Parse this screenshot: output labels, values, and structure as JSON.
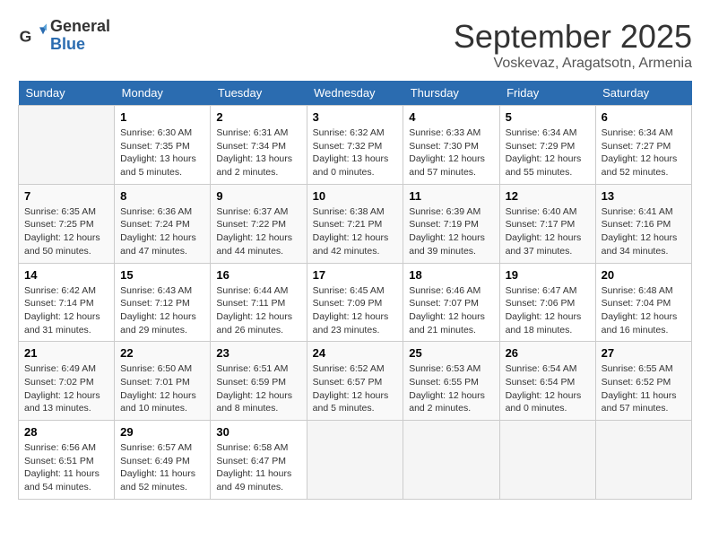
{
  "logo": {
    "general": "General",
    "blue": "Blue"
  },
  "header": {
    "month": "September 2025",
    "location": "Voskevaz, Aragatsotn, Armenia"
  },
  "days_of_week": [
    "Sunday",
    "Monday",
    "Tuesday",
    "Wednesday",
    "Thursday",
    "Friday",
    "Saturday"
  ],
  "weeks": [
    [
      {
        "day": "",
        "info": ""
      },
      {
        "day": "1",
        "info": "Sunrise: 6:30 AM\nSunset: 7:35 PM\nDaylight: 13 hours\nand 5 minutes."
      },
      {
        "day": "2",
        "info": "Sunrise: 6:31 AM\nSunset: 7:34 PM\nDaylight: 13 hours\nand 2 minutes."
      },
      {
        "day": "3",
        "info": "Sunrise: 6:32 AM\nSunset: 7:32 PM\nDaylight: 13 hours\nand 0 minutes."
      },
      {
        "day": "4",
        "info": "Sunrise: 6:33 AM\nSunset: 7:30 PM\nDaylight: 12 hours\nand 57 minutes."
      },
      {
        "day": "5",
        "info": "Sunrise: 6:34 AM\nSunset: 7:29 PM\nDaylight: 12 hours\nand 55 minutes."
      },
      {
        "day": "6",
        "info": "Sunrise: 6:34 AM\nSunset: 7:27 PM\nDaylight: 12 hours\nand 52 minutes."
      }
    ],
    [
      {
        "day": "7",
        "info": "Sunrise: 6:35 AM\nSunset: 7:25 PM\nDaylight: 12 hours\nand 50 minutes."
      },
      {
        "day": "8",
        "info": "Sunrise: 6:36 AM\nSunset: 7:24 PM\nDaylight: 12 hours\nand 47 minutes."
      },
      {
        "day": "9",
        "info": "Sunrise: 6:37 AM\nSunset: 7:22 PM\nDaylight: 12 hours\nand 44 minutes."
      },
      {
        "day": "10",
        "info": "Sunrise: 6:38 AM\nSunset: 7:21 PM\nDaylight: 12 hours\nand 42 minutes."
      },
      {
        "day": "11",
        "info": "Sunrise: 6:39 AM\nSunset: 7:19 PM\nDaylight: 12 hours\nand 39 minutes."
      },
      {
        "day": "12",
        "info": "Sunrise: 6:40 AM\nSunset: 7:17 PM\nDaylight: 12 hours\nand 37 minutes."
      },
      {
        "day": "13",
        "info": "Sunrise: 6:41 AM\nSunset: 7:16 PM\nDaylight: 12 hours\nand 34 minutes."
      }
    ],
    [
      {
        "day": "14",
        "info": "Sunrise: 6:42 AM\nSunset: 7:14 PM\nDaylight: 12 hours\nand 31 minutes."
      },
      {
        "day": "15",
        "info": "Sunrise: 6:43 AM\nSunset: 7:12 PM\nDaylight: 12 hours\nand 29 minutes."
      },
      {
        "day": "16",
        "info": "Sunrise: 6:44 AM\nSunset: 7:11 PM\nDaylight: 12 hours\nand 26 minutes."
      },
      {
        "day": "17",
        "info": "Sunrise: 6:45 AM\nSunset: 7:09 PM\nDaylight: 12 hours\nand 23 minutes."
      },
      {
        "day": "18",
        "info": "Sunrise: 6:46 AM\nSunset: 7:07 PM\nDaylight: 12 hours\nand 21 minutes."
      },
      {
        "day": "19",
        "info": "Sunrise: 6:47 AM\nSunset: 7:06 PM\nDaylight: 12 hours\nand 18 minutes."
      },
      {
        "day": "20",
        "info": "Sunrise: 6:48 AM\nSunset: 7:04 PM\nDaylight: 12 hours\nand 16 minutes."
      }
    ],
    [
      {
        "day": "21",
        "info": "Sunrise: 6:49 AM\nSunset: 7:02 PM\nDaylight: 12 hours\nand 13 minutes."
      },
      {
        "day": "22",
        "info": "Sunrise: 6:50 AM\nSunset: 7:01 PM\nDaylight: 12 hours\nand 10 minutes."
      },
      {
        "day": "23",
        "info": "Sunrise: 6:51 AM\nSunset: 6:59 PM\nDaylight: 12 hours\nand 8 minutes."
      },
      {
        "day": "24",
        "info": "Sunrise: 6:52 AM\nSunset: 6:57 PM\nDaylight: 12 hours\nand 5 minutes."
      },
      {
        "day": "25",
        "info": "Sunrise: 6:53 AM\nSunset: 6:55 PM\nDaylight: 12 hours\nand 2 minutes."
      },
      {
        "day": "26",
        "info": "Sunrise: 6:54 AM\nSunset: 6:54 PM\nDaylight: 12 hours\nand 0 minutes."
      },
      {
        "day": "27",
        "info": "Sunrise: 6:55 AM\nSunset: 6:52 PM\nDaylight: 11 hours\nand 57 minutes."
      }
    ],
    [
      {
        "day": "28",
        "info": "Sunrise: 6:56 AM\nSunset: 6:51 PM\nDaylight: 11 hours\nand 54 minutes."
      },
      {
        "day": "29",
        "info": "Sunrise: 6:57 AM\nSunset: 6:49 PM\nDaylight: 11 hours\nand 52 minutes."
      },
      {
        "day": "30",
        "info": "Sunrise: 6:58 AM\nSunset: 6:47 PM\nDaylight: 11 hours\nand 49 minutes."
      },
      {
        "day": "",
        "info": ""
      },
      {
        "day": "",
        "info": ""
      },
      {
        "day": "",
        "info": ""
      },
      {
        "day": "",
        "info": ""
      }
    ]
  ]
}
